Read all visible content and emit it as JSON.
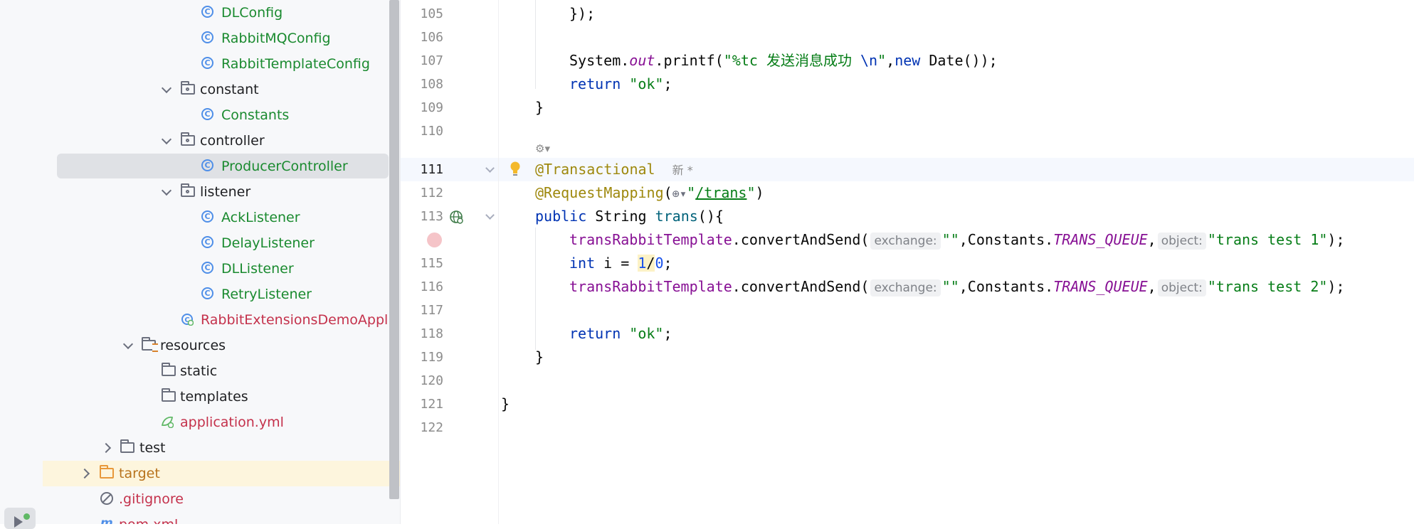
{
  "project_tree": {
    "items": [
      {
        "label": "DLConfig",
        "kind": "class"
      },
      {
        "label": "RabbitMQConfig",
        "kind": "class"
      },
      {
        "label": "RabbitTemplateConfig",
        "kind": "class"
      },
      {
        "label": "constant",
        "kind": "package"
      },
      {
        "label": "Constants",
        "kind": "class"
      },
      {
        "label": "controller",
        "kind": "package"
      },
      {
        "label": "ProducerController",
        "kind": "class",
        "selected": true
      },
      {
        "label": "listener",
        "kind": "package"
      },
      {
        "label": "AckListener",
        "kind": "class"
      },
      {
        "label": "DelayListener",
        "kind": "class"
      },
      {
        "label": "DLListener",
        "kind": "class"
      },
      {
        "label": "RetryListener",
        "kind": "class"
      },
      {
        "label": "RabbitExtensionsDemoApplication",
        "kind": "spring-app"
      },
      {
        "label": "resources",
        "kind": "resources-folder"
      },
      {
        "label": "static",
        "kind": "folder"
      },
      {
        "label": "templates",
        "kind": "folder"
      },
      {
        "label": "application.yml",
        "kind": "spring-config"
      },
      {
        "label": "test",
        "kind": "folder"
      },
      {
        "label": "target",
        "kind": "excluded-folder"
      },
      {
        "label": ".gitignore",
        "kind": "ignored-file"
      },
      {
        "label": "pom.xml",
        "kind": "maven"
      }
    ]
  },
  "editor": {
    "line_numbers": [
      "105",
      "106",
      "107",
      "108",
      "109",
      "110",
      "111",
      "112",
      "113",
      "",
      "115",
      "116",
      "117",
      "118",
      "119",
      "120",
      "121",
      "122"
    ],
    "current_line": "111",
    "inlay_new_tag": "新 *",
    "hint_exchange": "exchange:",
    "hint_object": "object:",
    "lines": {
      "l105": "});",
      "l107a": "System.",
      "l107b": "out",
      "l107c": ".printf(",
      "l107d": "\"%tc 发送消息成功 ",
      "l107e": "\\n",
      "l107f": "\"",
      "l107g": ",",
      "l107h": "new",
      "l107i": " Date());",
      "l108a": "return",
      "l108b": " ",
      "l108c": "\"ok\"",
      "l108d": ";",
      "l109": "}",
      "l111": "@Transactional",
      "l112a": "@RequestMapping",
      "l112b": "(",
      "l112c": "\"",
      "l112d": "/trans",
      "l112e": "\"",
      "l112f": ")",
      "l113a": "public",
      "l113b": " String ",
      "l113c": "trans",
      "l113d": "(){",
      "l114a": "transRabbitTemplate",
      "l114b": ".convertAndSend(",
      "l114c": "\"\"",
      "l114d": ",Constants.",
      "l114e": "TRANS_QUEUE",
      "l114f": ",",
      "l114g": "\"trans test 1\"",
      "l114h": ");",
      "l115a": "int",
      "l115b": " i = ",
      "l115c": "1",
      "l115d": "/",
      "l115e": "0",
      "l115f": ";",
      "l116a": "transRabbitTemplate",
      "l116b": ".convertAndSend(",
      "l116c": "\"\"",
      "l116d": ",Constants.",
      "l116e": "TRANS_QUEUE",
      "l116f": ",",
      "l116g": "\"trans test 2\"",
      "l116h": ");",
      "l118a": "return",
      "l118b": " ",
      "l118c": "\"ok\"",
      "l118d": ";",
      "l119": "}",
      "l121": "}"
    }
  },
  "colors": {
    "keyword": "#0033b3",
    "string": "#067d17",
    "field": "#871094",
    "annotation": "#9e880d",
    "method_decl": "#00627a",
    "number": "#1750eb",
    "class_label": "#1a8a2f",
    "error_label": "#c4314b"
  }
}
